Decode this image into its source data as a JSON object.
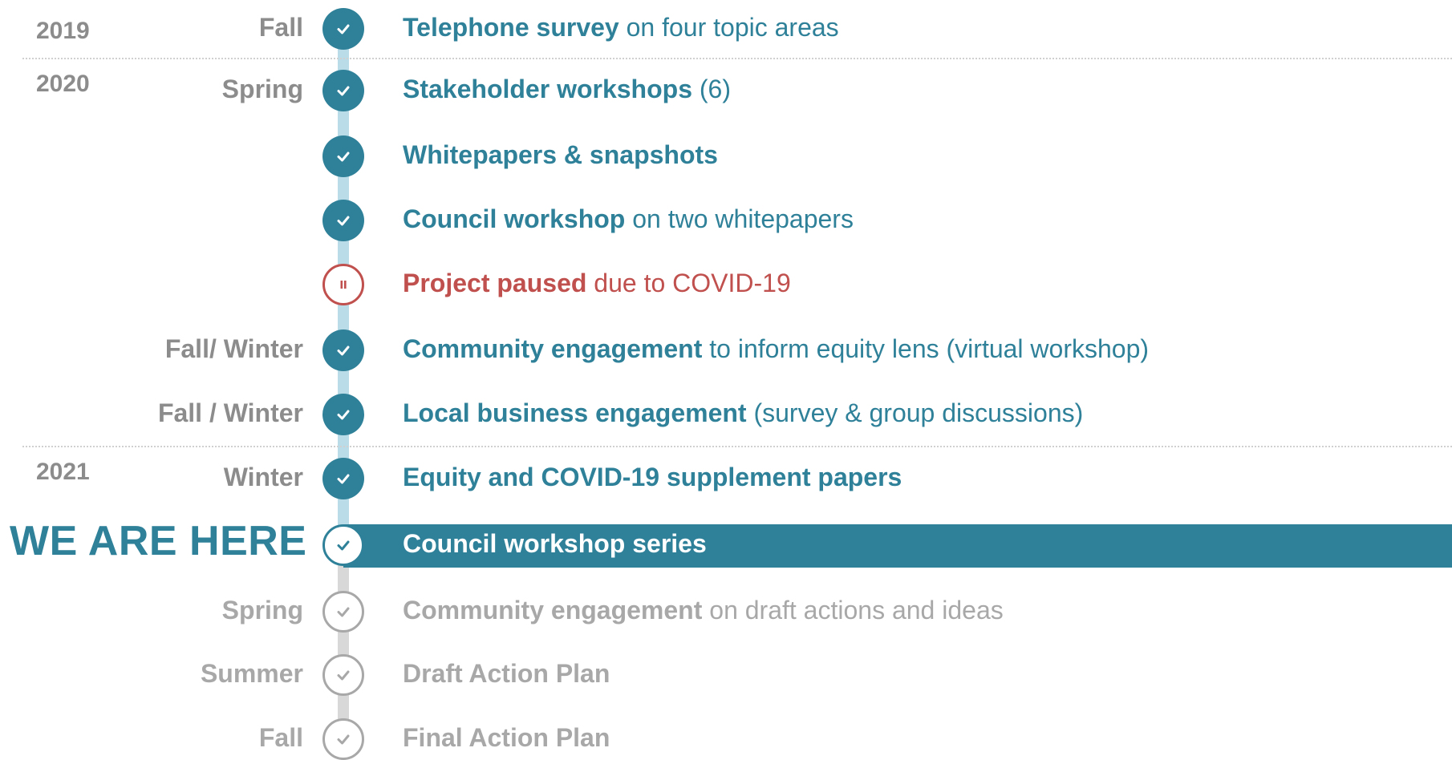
{
  "here_label": "WE ARE HERE",
  "years": [
    {
      "label": "2019"
    },
    {
      "label": "2020"
    },
    {
      "label": "2021"
    }
  ],
  "milestones": [
    {
      "season": "Fall",
      "bold": "Telephone survey",
      "rest": " on four topic areas",
      "status": "done"
    },
    {
      "season": "Spring",
      "bold": "Stakeholder workshops",
      "rest": " (6)",
      "status": "done"
    },
    {
      "season": "",
      "bold": "Whitepapers & snapshots",
      "rest": "",
      "status": "done"
    },
    {
      "season": "",
      "bold": "Council workshop",
      "rest": " on two whitepapers",
      "status": "done"
    },
    {
      "season": "",
      "bold": "Project paused",
      "rest": " due to COVID-19",
      "status": "paused"
    },
    {
      "season": "Fall/ Winter",
      "bold": "Community engagement",
      "rest": " to inform equity lens (virtual workshop)",
      "status": "done"
    },
    {
      "season": "Fall / Winter",
      "bold": "Local business engagement",
      "rest": " (survey & group discussions)",
      "status": "done"
    },
    {
      "season": "Winter",
      "bold": "Equity and COVID-19 supplement papers",
      "rest": "",
      "status": "done"
    },
    {
      "season": "",
      "bold": "Council workshop series",
      "rest": "",
      "status": "current"
    },
    {
      "season": "Spring",
      "bold": "Community engagement",
      "rest": " on draft actions and ideas",
      "status": "future"
    },
    {
      "season": "Summer",
      "bold": "Draft Action Plan",
      "rest": "",
      "status": "future"
    },
    {
      "season": "Fall",
      "bold": "Final Action Plan",
      "rest": "",
      "status": "future"
    }
  ],
  "colors": {
    "done": "#2f8199",
    "rail_done": "#b9dce8",
    "paused": "#c0504d",
    "future": "#a8a8a8",
    "rail_future": "#d8d8d8",
    "season_text": "#8c8c8c"
  },
  "icons": {
    "done": "check-circle-icon",
    "paused": "pause-circle-icon",
    "current": "check-circle-icon",
    "future": "check-circle-outline-icon"
  }
}
